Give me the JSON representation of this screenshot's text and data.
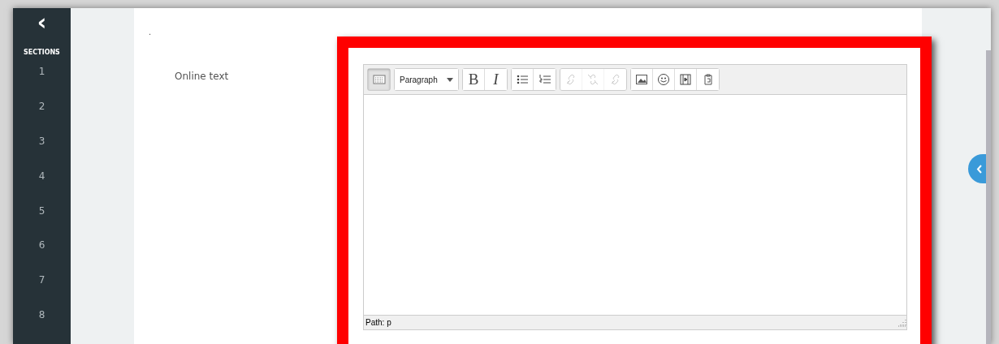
{
  "sidebar": {
    "back_icon": "‹",
    "title": "SECTIONS",
    "items": [
      "1",
      "2",
      "3",
      "4",
      "5",
      "6",
      "7",
      "8"
    ]
  },
  "content": {
    "marker": ".",
    "label": "Online text"
  },
  "editor": {
    "toolbar": [
      [
        {
          "kind": "toolbar-toggle",
          "selected": true,
          "disabled": false
        }
      ],
      [
        {
          "kind": "select",
          "value": "Paragraph"
        }
      ],
      [
        {
          "kind": "bold",
          "text": "B",
          "selected": false,
          "disabled": false
        },
        {
          "kind": "italic",
          "text": "I",
          "selected": false,
          "disabled": false
        }
      ],
      [
        {
          "kind": "bullets",
          "selected": false,
          "disabled": false
        },
        {
          "kind": "numbers",
          "selected": false,
          "disabled": false
        }
      ],
      [
        {
          "kind": "link",
          "selected": false,
          "disabled": true
        },
        {
          "kind": "unlink",
          "selected": false,
          "disabled": true
        },
        {
          "kind": "link",
          "selected": false,
          "disabled": true
        }
      ],
      [
        {
          "kind": "image",
          "selected": false,
          "disabled": false
        },
        {
          "kind": "smiley",
          "selected": false,
          "disabled": false
        },
        {
          "kind": "media",
          "selected": false,
          "disabled": false
        },
        {
          "kind": "paste",
          "selected": false,
          "disabled": false
        }
      ]
    ],
    "status": "Path: p"
  }
}
